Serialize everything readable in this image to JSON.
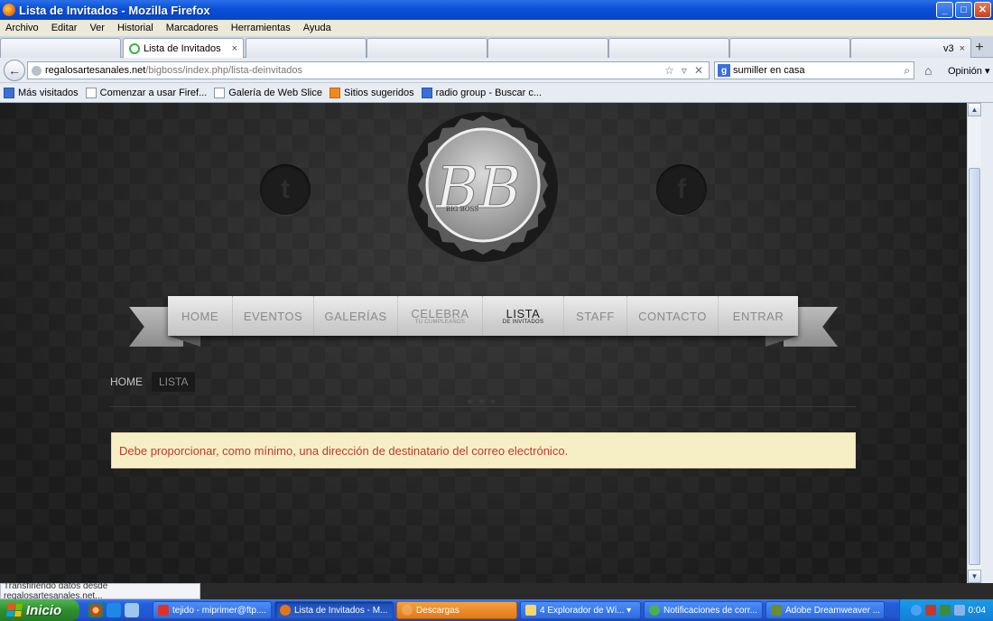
{
  "window": {
    "title": "Lista de Invitados - Mozilla Firefox",
    "buttons": {
      "minimize": "_",
      "maximize": "□",
      "close": "✕"
    }
  },
  "menubar": [
    "Archivo",
    "Editar",
    "Ver",
    "Historial",
    "Marcadores",
    "Herramientas",
    "Ayuda"
  ],
  "tabs": {
    "active_label": "Lista de Invitados",
    "close": "×",
    "partial_label": "v3",
    "new_tab": "+"
  },
  "navbar": {
    "back": "←",
    "url_domain": "regalosartesanales.net",
    "url_path": "/bigboss/index.php/lista-deinvitados",
    "url_tools": [
      "☆",
      "▿",
      "✕"
    ],
    "search_value": "sumiller en casa",
    "search_engine": "g",
    "search_icon": "⌕",
    "home_icon": "⌂",
    "opinion": "Opinión ▾"
  },
  "bookmarks": [
    {
      "label": "Más visitados",
      "icon": "blue"
    },
    {
      "label": "Comenzar a usar Firef...",
      "icon": "page"
    },
    {
      "label": "Galería de Web Slice",
      "icon": "page"
    },
    {
      "label": "Sitios sugeridos",
      "icon": "orange"
    },
    {
      "label": "radio group - Buscar c...",
      "icon": "blue"
    }
  ],
  "page": {
    "social": {
      "twitter": "t",
      "facebook": "f"
    },
    "logo": {
      "monogram": "BB",
      "text": "BIG BOSS"
    },
    "nav": [
      {
        "label": "HOME",
        "sub": ""
      },
      {
        "label": "EVENTOS",
        "sub": ""
      },
      {
        "label": "GALERÍAS",
        "sub": ""
      },
      {
        "label": "CELEBRA",
        "sub": "TU CUMPLEAÑOS"
      },
      {
        "label": "LISTA",
        "sub": "DE INVITADOS",
        "active": true
      },
      {
        "label": "STAFF",
        "sub": ""
      },
      {
        "label": "CONTACTO",
        "sub": ""
      },
      {
        "label": "ENTRAR",
        "sub": ""
      }
    ],
    "breadcrumb": {
      "home": "HOME",
      "current": "LISTA"
    },
    "divider": "★★★",
    "alert": "Debe proporcionar, como mínimo, una dirección de destinatario del correo electrónico."
  },
  "scrollbar": {
    "up": "▲",
    "down": "▼"
  },
  "status": "Transfiriendo datos desde regalosartesanales.net...",
  "taskbar": {
    "start": "Inicio",
    "items": [
      {
        "label": "tejido - miprimer@ftp....",
        "color": "#d9342b"
      },
      {
        "label": "Lista de Invitados - M...",
        "color": "#e8741a",
        "active": true
      },
      {
        "label": "Descargas",
        "color": "#e8741a",
        "orange": true
      },
      {
        "label": "4 Explorador de Wi...  ▾",
        "color": "#f5d76e"
      },
      {
        "label": "Notificaciones de corr...",
        "color": "#4caf50"
      },
      {
        "label": "Adobe Dreamweaver ...",
        "color": "#6a8d2f"
      }
    ],
    "clock": "0:04"
  },
  "colors": {
    "alert_text": "#c0392b",
    "alert_bg": "#f6efc6",
    "page_bg": "#2a2a2a"
  }
}
